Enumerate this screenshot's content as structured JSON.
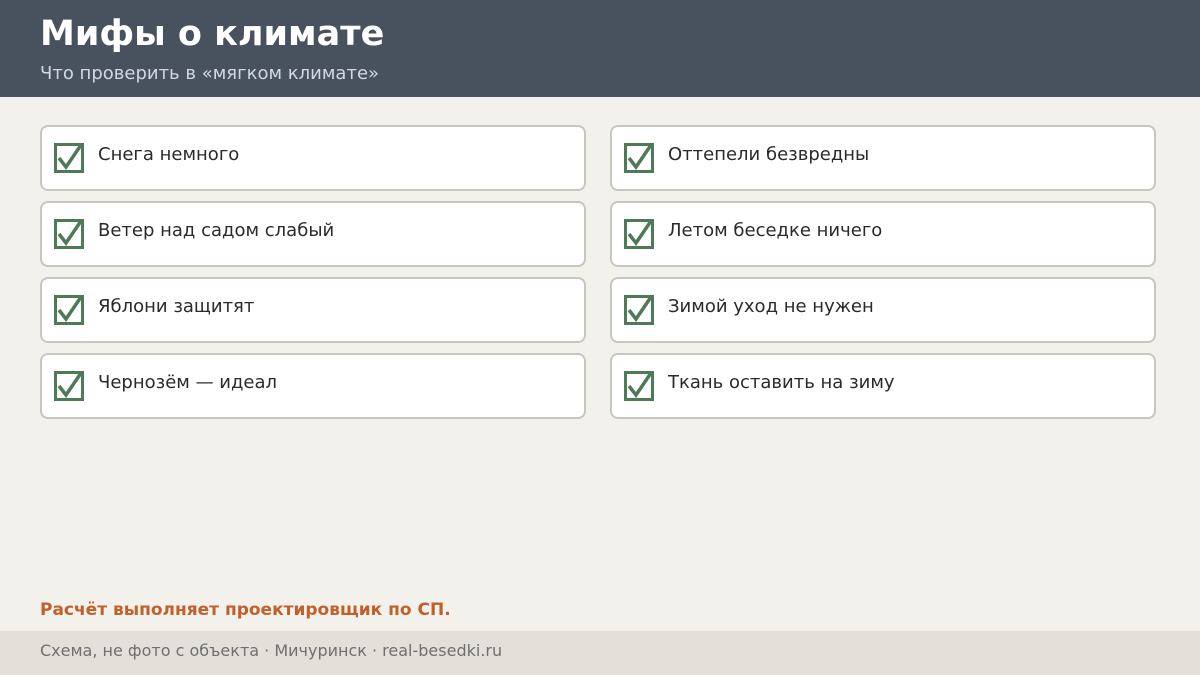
{
  "header": {
    "title": "Мифы о климате",
    "subtitle": "Что проверить в «мягком климате»"
  },
  "items": [
    {
      "label": "Снега немного"
    },
    {
      "label": "Оттепели безвредны"
    },
    {
      "label": "Ветер над садом слабый"
    },
    {
      "label": "Летом беседке ничего"
    },
    {
      "label": "Яблони защитят"
    },
    {
      "label": "Зимой уход не нужен"
    },
    {
      "label": "Чернозём — идеал"
    },
    {
      "label": "Ткань оставить на зиму"
    }
  ],
  "icons": {
    "item_icon": "checkbox-checked-icon"
  },
  "note": "Расчёт выполняет проектировщик по СП.",
  "footer": {
    "text": "Схема, не фото с объекта · Мичуринск · real-besedki.ru"
  },
  "colors": {
    "header_bg": "#48525e",
    "page_bg": "#f3f1ec",
    "check_green": "#4e7a58",
    "note_orange": "#c0602a",
    "footer_bg": "#e3e0da"
  }
}
